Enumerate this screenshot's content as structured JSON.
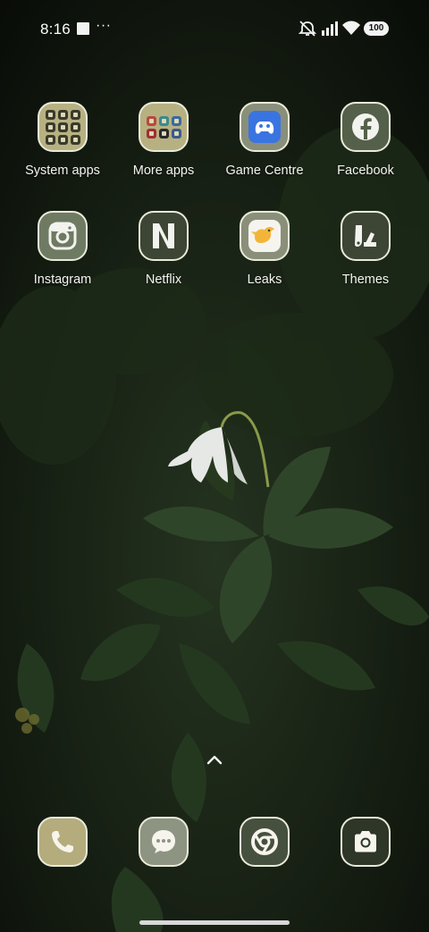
{
  "status_bar": {
    "time": "8:16",
    "more_indicator": "···",
    "battery_level": "100",
    "icons": [
      "screenshot-notification-icon",
      "mute-icon",
      "signal-icon",
      "wifi-icon",
      "battery-icon"
    ]
  },
  "home": {
    "apps": [
      {
        "label": "System apps",
        "icon": "folder-icon"
      },
      {
        "label": "More apps",
        "icon": "folder-icon"
      },
      {
        "label": "Game Centre",
        "icon": "game-controller-icon"
      },
      {
        "label": "Facebook",
        "icon": "facebook-icon"
      },
      {
        "label": "Instagram",
        "icon": "instagram-icon"
      },
      {
        "label": "Netflix",
        "icon": "netflix-icon"
      },
      {
        "label": "Leaks",
        "icon": "bird-icon"
      },
      {
        "label": "Themes",
        "icon": "themes-icon"
      }
    ],
    "app_drawer_hint": "chevron-up-icon"
  },
  "dock": {
    "items": [
      {
        "name": "phone",
        "icon": "phone-icon"
      },
      {
        "name": "messages",
        "icon": "chat-bubble-icon"
      },
      {
        "name": "chrome",
        "icon": "chrome-icon"
      },
      {
        "name": "camera",
        "icon": "camera-icon"
      }
    ]
  },
  "colors": {
    "tile_tint": "#7f8a6e",
    "folder_tint": "#b7b182",
    "tile_border": "#e8ead8",
    "wallpaper_dark": "#0d120b",
    "leaf_green": "#2f4529"
  }
}
